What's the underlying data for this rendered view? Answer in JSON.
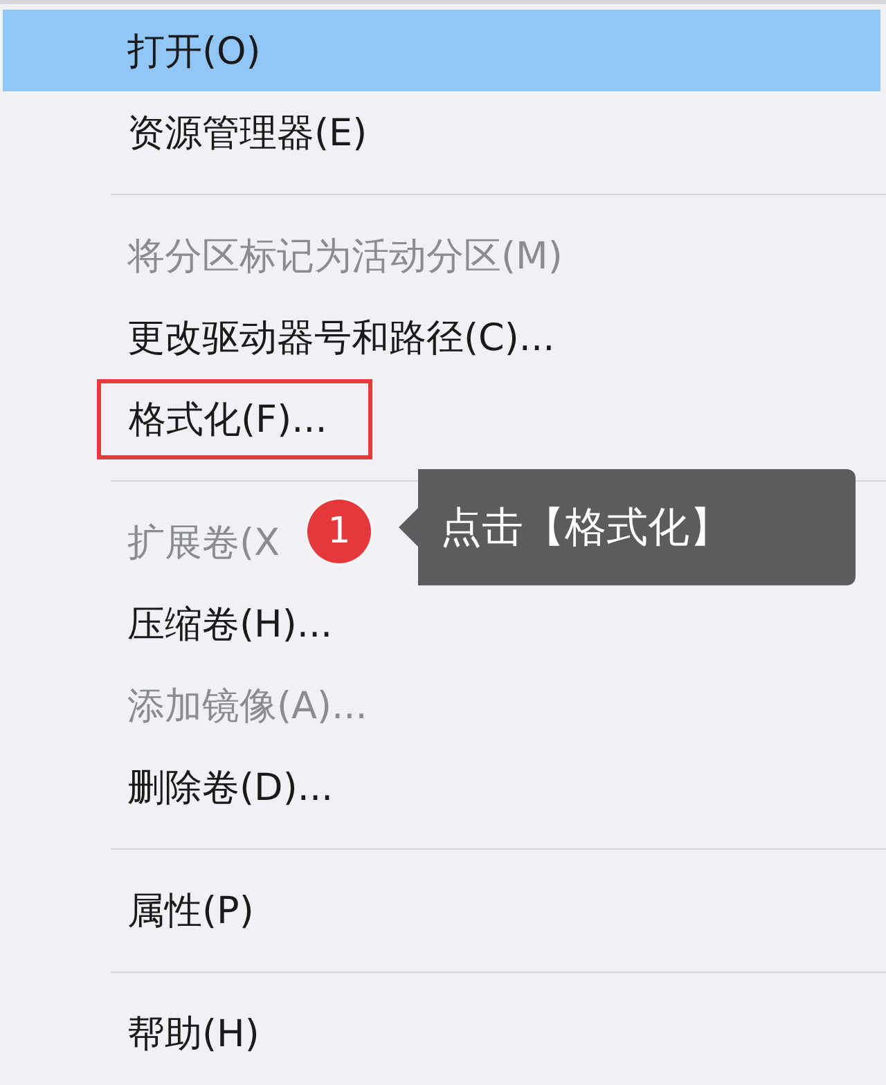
{
  "menu": {
    "items": [
      {
        "kind": "item",
        "label": "打开(O)",
        "disabled": false,
        "selected": true,
        "marked": false
      },
      {
        "kind": "item",
        "label": "资源管理器(E)",
        "disabled": false,
        "selected": false,
        "marked": false
      },
      {
        "kind": "separator"
      },
      {
        "kind": "item",
        "label": "将分区标记为活动分区(M)",
        "disabled": true,
        "selected": false,
        "marked": false
      },
      {
        "kind": "item",
        "label": "更改驱动器号和路径(C)...",
        "disabled": false,
        "selected": false,
        "marked": false
      },
      {
        "kind": "item",
        "label": "格式化(F)...",
        "disabled": false,
        "selected": false,
        "marked": true
      },
      {
        "kind": "separator"
      },
      {
        "kind": "item",
        "label": "扩展卷(X",
        "disabled": true,
        "selected": false,
        "marked": false
      },
      {
        "kind": "item",
        "label": "压缩卷(H)...",
        "disabled": false,
        "selected": false,
        "marked": false
      },
      {
        "kind": "item",
        "label": "添加镜像(A)...",
        "disabled": true,
        "selected": false,
        "marked": false
      },
      {
        "kind": "item",
        "label": "删除卷(D)...",
        "disabled": false,
        "selected": false,
        "marked": false
      },
      {
        "kind": "separator"
      },
      {
        "kind": "item",
        "label": "属性(P)",
        "disabled": false,
        "selected": false,
        "marked": false
      },
      {
        "kind": "separator"
      },
      {
        "kind": "item",
        "label": "帮助(H)",
        "disabled": false,
        "selected": false,
        "marked": false
      }
    ]
  },
  "annotation": {
    "step": "1",
    "tooltip": "点击【格式化】"
  }
}
